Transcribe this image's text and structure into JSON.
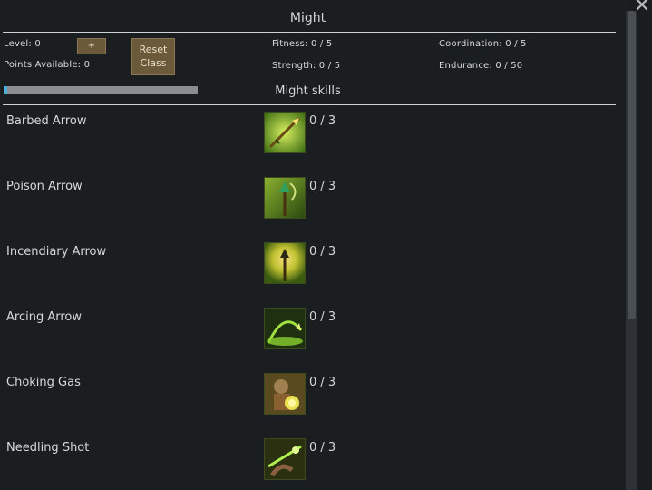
{
  "header": {
    "title": "Might"
  },
  "stats": {
    "level": "Level: 0",
    "points": "Points Available: 0",
    "plus_label": "+",
    "reset_label": "Reset\nClass",
    "fitness": "Fitness: 0 / 5",
    "strength": "Strength: 0 / 5",
    "coordination": "Coordination: 0 / 5",
    "endurance": "Endurance: 0 / 50"
  },
  "progress": {
    "fraction": 0.02,
    "color": "#4ab0d8"
  },
  "skills_header": {
    "title": "Might skills"
  },
  "skills": [
    {
      "name": "Barbed Arrow",
      "rank": "0 / 3",
      "icon": "barbed-arrow-icon"
    },
    {
      "name": "Poison Arrow",
      "rank": "0 / 3",
      "icon": "poison-arrow-icon"
    },
    {
      "name": "Incendiary Arrow",
      "rank": "0 / 3",
      "icon": "incendiary-arrow-icon"
    },
    {
      "name": "Arcing Arrow",
      "rank": "0 / 3",
      "icon": "arcing-arrow-icon"
    },
    {
      "name": "Choking Gas",
      "rank": "0 / 3",
      "icon": "choking-gas-icon"
    },
    {
      "name": "Needling Shot",
      "rank": "0 / 3",
      "icon": "needling-shot-icon"
    }
  ],
  "window": {
    "close_glyph": "✕"
  }
}
